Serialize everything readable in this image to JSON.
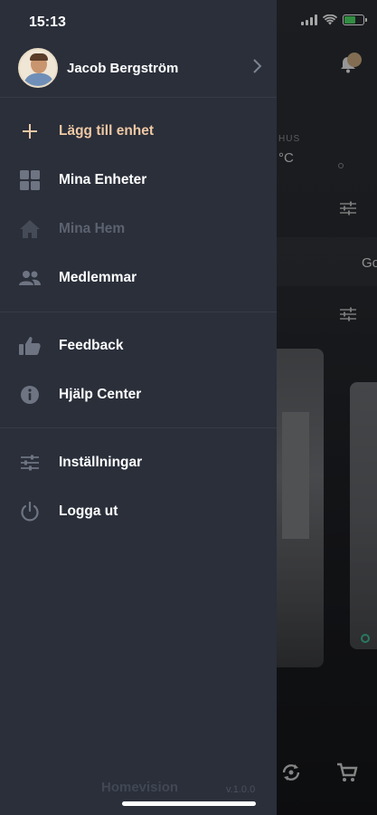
{
  "status_bar": {
    "time": "15:13"
  },
  "profile": {
    "name": "Jacob Bergström"
  },
  "menu": {
    "group1": [
      {
        "label": "Lägg till enhet",
        "icon": "plus-icon",
        "state": "accent"
      },
      {
        "label": "Mina Enheter",
        "icon": "grid-icon",
        "state": "normal"
      },
      {
        "label": "Mina Hem",
        "icon": "home-icon",
        "state": "disabled"
      },
      {
        "label": "Medlemmar",
        "icon": "people-icon",
        "state": "normal"
      }
    ],
    "group2": [
      {
        "label": "Feedback",
        "icon": "thumbs-up-icon",
        "state": "normal"
      },
      {
        "label": "Hjälp Center",
        "icon": "info-icon",
        "state": "normal"
      }
    ],
    "group3": [
      {
        "label": "Inställningar",
        "icon": "sliders-icon",
        "state": "normal"
      },
      {
        "label": "Logga ut",
        "icon": "power-icon",
        "state": "normal"
      }
    ]
  },
  "footer": {
    "brand": "Homevision",
    "version": "v.1.0.0"
  },
  "background": {
    "section_label": "HUS",
    "temperature": "°C",
    "partial_text": "Go"
  },
  "colors": {
    "drawer_bg": "#2a2f3a",
    "accent": "#efc8a4",
    "disabled": "#5c6270"
  }
}
